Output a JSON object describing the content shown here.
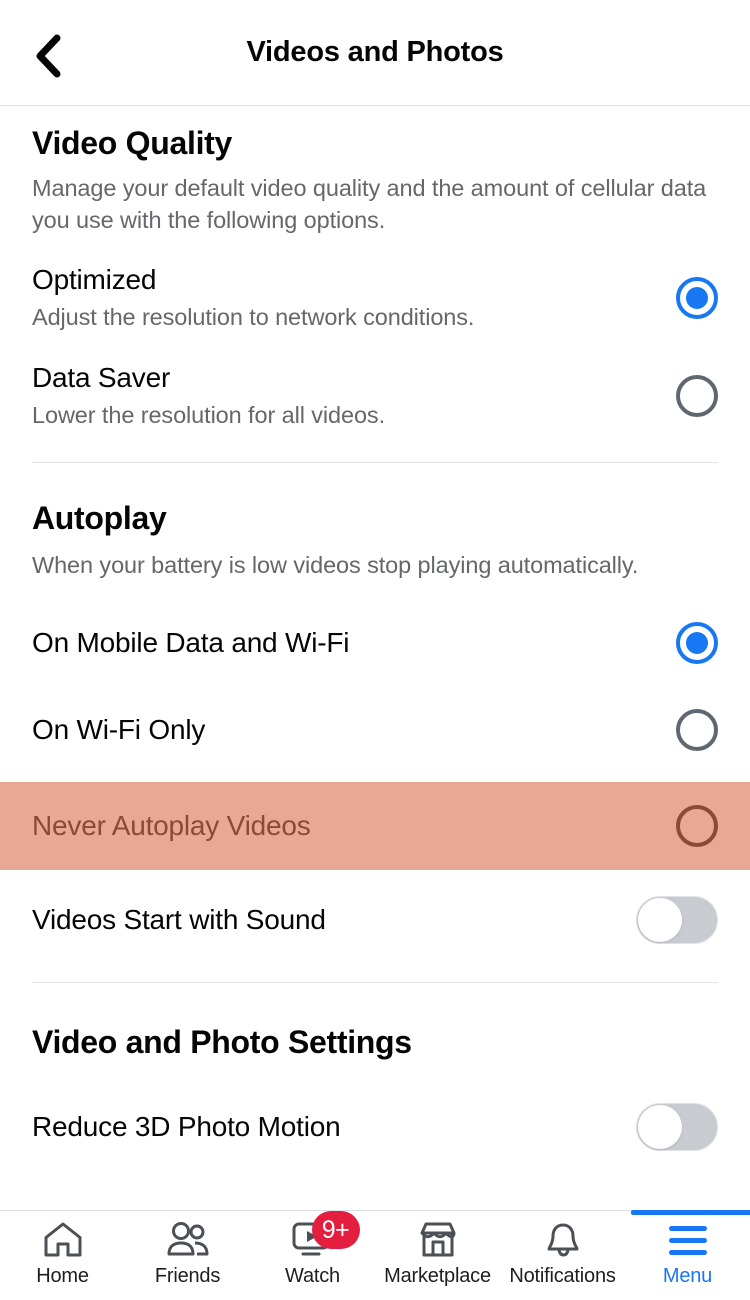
{
  "header": {
    "title": "Videos and Photos",
    "back_icon": "chevron-left-icon"
  },
  "sections": {
    "video_quality": {
      "title": "Video Quality",
      "description": "Manage your default video quality and the amount of cellular data you use with the following options.",
      "options": [
        {
          "title": "Optimized",
          "subtitle": "Adjust the resolution to network conditions.",
          "selected": true
        },
        {
          "title": "Data Saver",
          "subtitle": "Lower the resolution for all videos.",
          "selected": false
        }
      ]
    },
    "autoplay": {
      "title": "Autoplay",
      "description": "When your battery is low videos stop playing automatically.",
      "options": [
        {
          "title": "On Mobile Data and Wi-Fi",
          "selected": true,
          "highlighted": false
        },
        {
          "title": "On Wi-Fi Only",
          "selected": false,
          "highlighted": false
        },
        {
          "title": "Never Autoplay Videos",
          "selected": false,
          "highlighted": true
        }
      ],
      "toggle": {
        "title": "Videos Start with Sound",
        "on": false
      }
    },
    "video_photo_settings": {
      "title": "Video and Photo Settings",
      "toggle": {
        "title": "Reduce 3D Photo Motion",
        "on": false
      }
    }
  },
  "bottom_nav": {
    "items": [
      {
        "label": "Home",
        "icon": "home-icon",
        "active": false,
        "badge": ""
      },
      {
        "label": "Friends",
        "icon": "friends-icon",
        "active": false,
        "badge": ""
      },
      {
        "label": "Watch",
        "icon": "watch-icon",
        "active": false,
        "badge": "9+"
      },
      {
        "label": "Marketplace",
        "icon": "marketplace-icon",
        "active": false,
        "badge": ""
      },
      {
        "label": "Notifications",
        "icon": "bell-icon",
        "active": false,
        "badge": ""
      },
      {
        "label": "Menu",
        "icon": "hamburger-icon",
        "active": true,
        "badge": ""
      }
    ]
  },
  "colors": {
    "accent": "#1877f2",
    "badge": "#e41e3f",
    "highlight_bg": "#e8a894",
    "highlight_text": "#8a4a38",
    "secondary_text": "#65676b"
  }
}
